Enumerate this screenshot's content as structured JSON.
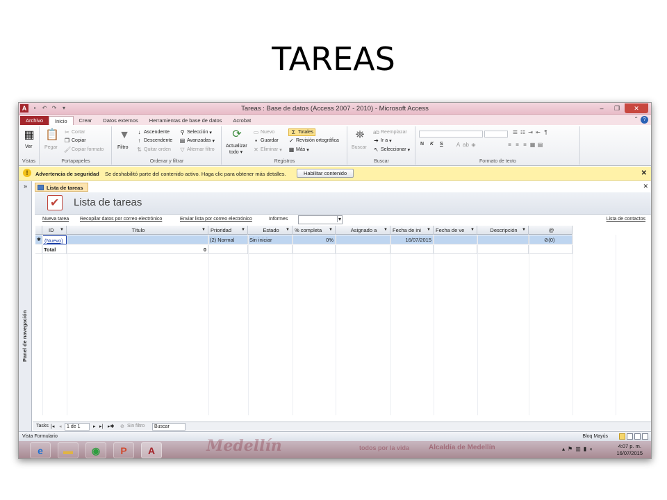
{
  "slide": {
    "title": "TAREAS"
  },
  "window": {
    "title": "Tareas : Base de datos (Access 2007 - 2010)  -  Microsoft Access",
    "app_icon": "A"
  },
  "tabs": [
    "Archivo",
    "Inicio",
    "Crear",
    "Datos externos",
    "Herramientas de base de datos",
    "Acrobat"
  ],
  "ribbon": {
    "vistas": {
      "ver": "Ver",
      "label": "Vistas"
    },
    "portapapeles": {
      "pegar": "Pegar",
      "cortar": "Cortar",
      "copiar": "Copiar",
      "copiar_formato": "Copiar formato",
      "label": "Portapapeles"
    },
    "ordenar": {
      "filtro": "Filtro",
      "ascendente": "Ascendente",
      "descendente": "Descendente",
      "quitar_orden": "Quitar orden",
      "seleccion": "Selección",
      "avanzadas": "Avanzadas",
      "alternar_filtro": "Alternar filtro",
      "label": "Ordenar y filtrar"
    },
    "registros": {
      "actualizar": "Actualizar",
      "actualizar2": "todo",
      "nuevo": "Nuevo",
      "guardar": "Guardar",
      "eliminar": "Eliminar",
      "totales": "Totales",
      "revision": "Revisión ortográfica",
      "mas": "Más",
      "label": "Registros"
    },
    "buscar": {
      "buscar": "Buscar",
      "reemplazar": "Reemplazar",
      "ir_a": "Ir a",
      "seleccionar": "Seleccionar",
      "label": "Buscar"
    },
    "formato": {
      "bold": "N",
      "italic": "K",
      "underline": "S",
      "label": "Formato de texto"
    }
  },
  "security": {
    "title": "Advertencia de seguridad",
    "message": "Se deshabilitó parte del contenido activo. Haga clic para obtener más detalles.",
    "button": "Habilitar contenido"
  },
  "nav_pane": {
    "label": "Panel de navegación"
  },
  "document": {
    "tab": "Lista de tareas",
    "form_title": "Lista de tareas"
  },
  "actions": {
    "nueva": "Nueva tarea",
    "recopilar": "Recopilar datos por correo electrónico",
    "enviar": "Enviar lista por correo electrónico",
    "informes": "Informes",
    "contactos": "Lista de contactos"
  },
  "table": {
    "columns": [
      "ID",
      "Título",
      "Prioridad",
      "Estado",
      "% completa",
      "Asignado a",
      "Fecha de ini",
      "Fecha de ve",
      "Descripción",
      "@"
    ],
    "new_row": {
      "id": "(Nuevo)",
      "prioridad": "(2) Normal",
      "estado": "Sin iniciar",
      "completa": "0%",
      "fecha": "16/07/2015",
      "adjuntos": "(0)"
    },
    "total_row": {
      "label": "Total",
      "value": "0"
    }
  },
  "record_nav": {
    "label": "Tasks",
    "position": "1 de 1",
    "filter": "Sin filtro",
    "search": "Buscar"
  },
  "status": {
    "view": "Vista Formulario",
    "caps": "Bloq Mayús"
  },
  "taskbar": {
    "watermark1": "Medellín",
    "watermark2": "todos por la vida",
    "watermark3": "Alcaldía de Medellín",
    "time": "4:07 p. m.",
    "date": "16/07/2015"
  }
}
